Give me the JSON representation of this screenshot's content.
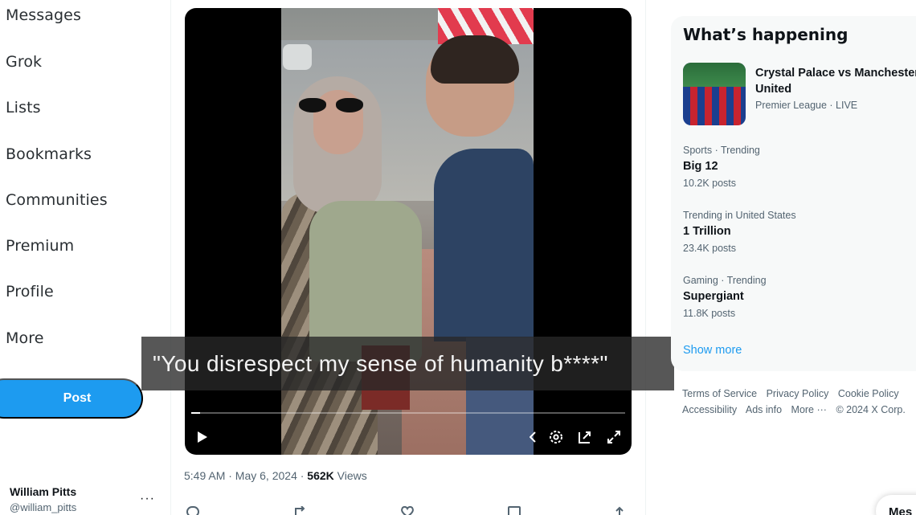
{
  "nav": {
    "items": [
      "Messages",
      "Grok",
      "Lists",
      "Bookmarks",
      "Communities",
      "Premium",
      "Profile",
      "More"
    ],
    "post_label": "Post"
  },
  "account": {
    "name": "William Pitts",
    "handle": "@william_pitts"
  },
  "video": {
    "progress_fraction": 0.02
  },
  "caption": {
    "text": "\"You disrespect my sense of humanity b****\""
  },
  "tweet": {
    "time": "5:49 AM · May 6, 2024 · ",
    "views_count": "562K",
    "views_label": " Views"
  },
  "trends": {
    "title": "What’s happening",
    "featured": {
      "title_line1": "Crystal Palace vs Manchester",
      "title_line2": "United",
      "subtitle": "Premier League · LIVE"
    },
    "items": [
      {
        "context": "Sports · Trending",
        "name": "Big 12",
        "count": "10.2K posts"
      },
      {
        "context": "Trending in United States",
        "name": "1 Trillion",
        "count": "23.4K posts"
      },
      {
        "context": "Gaming · Trending",
        "name": "Supergiant",
        "count": "11.8K posts"
      }
    ],
    "show_more": "Show more"
  },
  "footer": {
    "links": [
      "Terms of Service",
      "Privacy Policy",
      "Cookie Policy",
      "Accessibility",
      "Ads info",
      "More ···",
      "© 2024 X Corp."
    ]
  },
  "messages_pill": "Mes",
  "colors": {
    "accent": "#1d9bf0",
    "text": "#0f1419",
    "muted": "#536471",
    "panel": "#f7f9f9"
  }
}
